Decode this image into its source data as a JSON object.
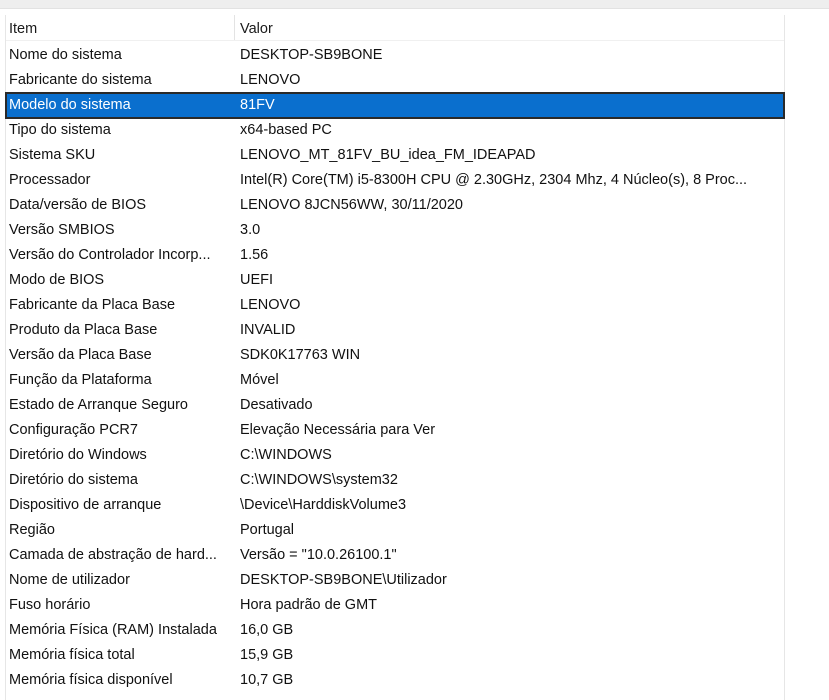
{
  "header": {
    "item": "Item",
    "value": "Valor"
  },
  "colors": {
    "selection": "#0a6fce"
  },
  "selected_index": 2,
  "rows": [
    {
      "item": "Nome do sistema",
      "value": "DESKTOP-SB9BONE"
    },
    {
      "item": "Fabricante do sistema",
      "value": "LENOVO"
    },
    {
      "item": "Modelo do sistema",
      "value": "81FV"
    },
    {
      "item": "Tipo do sistema",
      "value": "x64-based PC"
    },
    {
      "item": "Sistema SKU",
      "value": "LENOVO_MT_81FV_BU_idea_FM_IDEAPAD"
    },
    {
      "item": "Processador",
      "value": "Intel(R) Core(TM) i5-8300H CPU @ 2.30GHz, 2304 Mhz, 4 Núcleo(s), 8 Proc..."
    },
    {
      "item": "Data/versão de BIOS",
      "value": "LENOVO 8JCN56WW, 30/11/2020"
    },
    {
      "item": "Versão SMBIOS",
      "value": "3.0"
    },
    {
      "item": "Versão do Controlador Incorp...",
      "value": "1.56"
    },
    {
      "item": "Modo de BIOS",
      "value": "UEFI"
    },
    {
      "item": "Fabricante da Placa Base",
      "value": "LENOVO"
    },
    {
      "item": "Produto da Placa Base",
      "value": "INVALID"
    },
    {
      "item": "Versão da Placa Base",
      "value": "SDK0K17763 WIN"
    },
    {
      "item": "Função da Plataforma",
      "value": "Móvel"
    },
    {
      "item": "Estado de Arranque Seguro",
      "value": "Desativado"
    },
    {
      "item": "Configuração PCR7",
      "value": "Elevação Necessária para Ver"
    },
    {
      "item": "Diretório do Windows",
      "value": "C:\\WINDOWS"
    },
    {
      "item": "Diretório do sistema",
      "value": "C:\\WINDOWS\\system32"
    },
    {
      "item": "Dispositivo de arranque",
      "value": "\\Device\\HarddiskVolume3"
    },
    {
      "item": "Região",
      "value": "Portugal"
    },
    {
      "item": "Camada de abstração de hard...",
      "value": "Versão = \"10.0.26100.1\""
    },
    {
      "item": "Nome de utilizador",
      "value": "DESKTOP-SB9BONE\\Utilizador"
    },
    {
      "item": "Fuso horário",
      "value": "Hora padrão de GMT"
    },
    {
      "item": "Memória Física (RAM) Instalada",
      "value": "16,0 GB"
    },
    {
      "item": "Memória física total",
      "value": "15,9 GB"
    },
    {
      "item": "Memória física disponível",
      "value": "10,7 GB"
    }
  ]
}
